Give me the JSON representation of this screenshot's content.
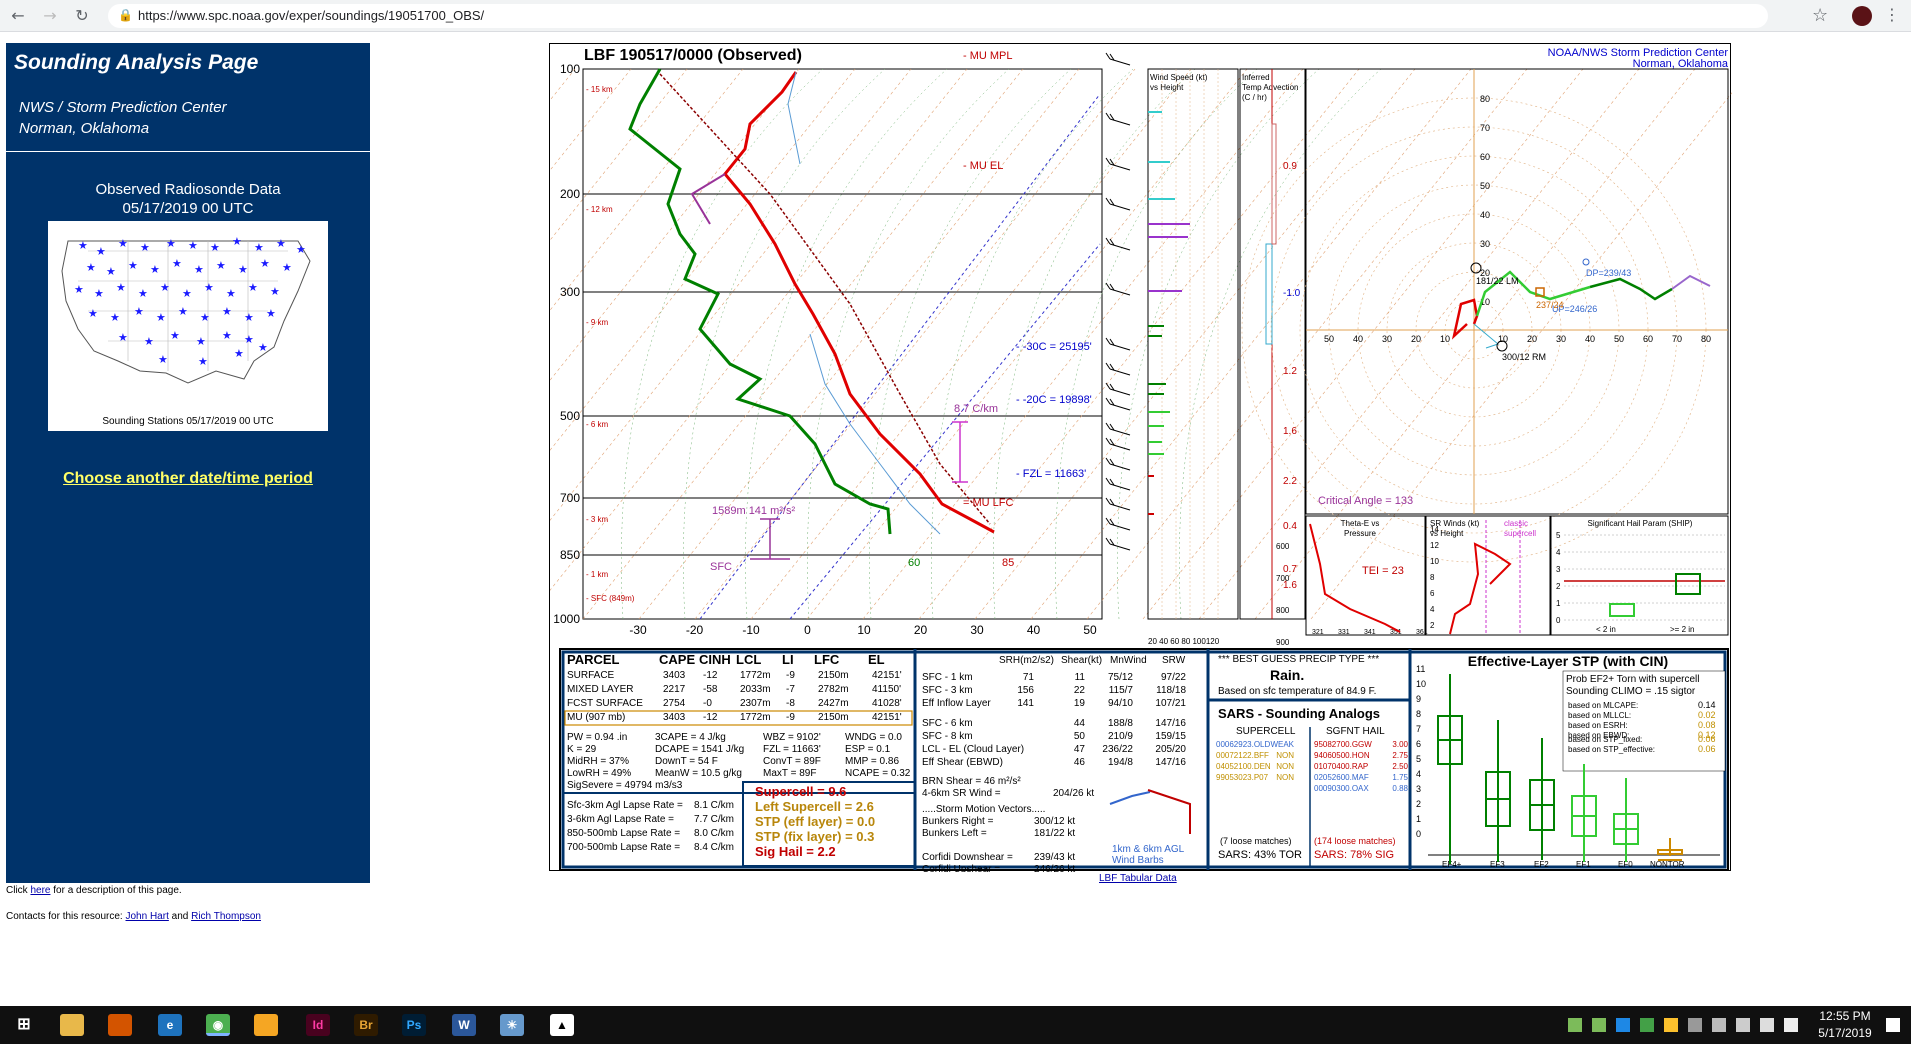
{
  "browser": {
    "url": "https://www.spc.noaa.gov/exper/soundings/19051700_OBS/"
  },
  "left": {
    "title": "Sounding Analysis Page",
    "sub1": "NWS / Storm Prediction Center",
    "sub2": "Norman, Oklahoma",
    "obs_title": "Observed Radiosonde Data",
    "obs_date": "05/17/2019 00 UTC",
    "map_caption": "Sounding Stations 05/17/2019 00 UTC",
    "choose_link": "Choose another date/time period"
  },
  "footer": {
    "click": "Click ",
    "here": "here",
    "desc": " for a description of this page.",
    "contacts": "Contacts for this resource: ",
    "name1": "John Hart",
    "and": " and ",
    "name2": "Rich Thompson"
  },
  "sounding": {
    "header": "LBF   190517/0000  (Observed)",
    "org1": "NOAA/NWS Storm Prediction Center",
    "org2": "Norman, Oklahoma",
    "mu_mpl": "MU MPL",
    "mu_el": "MU EL",
    "mu_lfc": "MU LFC",
    "lev_30c": "-30C = 25195'",
    "lev_20c": "-20C = 19898'",
    "fzl": "FZL = 11663'",
    "lapse": "8.7 C/km",
    "srh_lbl": "1589m    141 m²/s²",
    "sfc_lbl": "SFC",
    "td_sfc": "60",
    "t_sfc": "85",
    "press_labels": [
      "100",
      "200",
      "300",
      "500",
      "700",
      "850",
      "1000"
    ],
    "height_labels": [
      "15 km",
      "12 km",
      "9 km",
      "6 km",
      "3 km",
      "1 km",
      "SFC (849m)"
    ],
    "temp_ticks": [
      "-30",
      "-20",
      "-10",
      "0",
      "10",
      "20",
      "30",
      "40",
      "50"
    ],
    "wind_hdr1": "Wind Speed (kt)",
    "wind_hdr2": "vs Height",
    "adv_hdr1": "Inferred",
    "adv_hdr2": "Temp Advection",
    "adv_hdr3": "(C / hr)",
    "adv_vals": [
      "0.9",
      "-1.0",
      "1.2",
      "1.6",
      "2.2",
      "0.4",
      "0.7",
      "1.6"
    ],
    "wind_ticks": "20  40  60  80  100120",
    "hodo_labels": {
      "lm": "181/22 LM",
      "rm": "300/12 RM",
      "dp": "DP=239/43",
      "up": "UP=246/26",
      "crit": "Critical Angle = 133",
      "box": "237/24"
    },
    "hodo_rings": [
      "10",
      "20",
      "30",
      "40",
      "50",
      "60",
      "70",
      "80"
    ],
    "hodo_x": [
      "50",
      "40",
      "30",
      "20",
      "10",
      "10",
      "20",
      "30",
      "40",
      "50",
      "60",
      "70",
      "80"
    ]
  },
  "insets": {
    "theta_title1": "Theta-E vs",
    "theta_title2": "Pressure",
    "tei": "TEI = 23",
    "theta_x": [
      "321",
      "331",
      "341",
      "351",
      "361"
    ],
    "theta_p": [
      "600",
      "700",
      "800",
      "900"
    ],
    "srw_title1": "SR Winds (kt)",
    "srw_title2": "vs Height",
    "srw_classic1": "classic",
    "srw_classic2": "supercell",
    "srw_y": [
      "14",
      "12",
      "10",
      "8",
      "6",
      "4",
      "2"
    ],
    "ship_title": "Significant Hail Param (SHIP)",
    "ship_y": [
      "5",
      "4",
      "3",
      "2",
      "1",
      "0"
    ],
    "ship_x1": "< 2 in",
    "ship_x2": ">= 2 in"
  },
  "parcel_table": {
    "headers": [
      "PARCEL",
      "CAPE",
      "CINH",
      "LCL",
      "LI",
      "LFC",
      "EL"
    ],
    "rows": [
      [
        "SURFACE",
        "3403",
        "-12",
        "1772m",
        "-9",
        "2150m",
        "42151'"
      ],
      [
        "MIXED LAYER",
        "2217",
        "-58",
        "2033m",
        "-7",
        "2782m",
        "41150'"
      ],
      [
        "FCST SURFACE",
        "2754",
        "-0",
        "2307m",
        "-8",
        "2427m",
        "41028'"
      ],
      [
        "MU   (907 mb)",
        "3403",
        "-12",
        "1772m",
        "-9",
        "2150m",
        "42151'"
      ]
    ]
  },
  "indices": [
    [
      "PW = 0.94 .in",
      "3CAPE = 4 J/kg",
      "WBZ = 9102'",
      "WNDG = 0.0"
    ],
    [
      "K = 29",
      "DCAPE = 1541 J/kg",
      "FZL = 11663'",
      "ESP = 0.1"
    ],
    [
      "MidRH = 37%",
      "DownT = 54 F",
      "ConvT = 89F",
      "MMP = 0.86"
    ],
    [
      "LowRH = 49%",
      "MeanW = 10.5 g/kg",
      "MaxT = 89F",
      "NCAPE = 0.32"
    ]
  ],
  "sigsevere": "SigSevere = 49794 m3/s3",
  "lapse_rates": [
    [
      "Sfc-3km Agl Lapse Rate =",
      "8.1 C/km"
    ],
    [
      "3-6km Agl Lapse Rate =",
      "7.7 C/km"
    ],
    [
      "850-500mb Lapse Rate =",
      "8.0 C/km"
    ],
    [
      "700-500mb Lapse Rate =",
      "8.4 C/km"
    ]
  ],
  "composites": [
    {
      "label": "Supercell = 9.6",
      "color": "#c00000"
    },
    {
      "label": "Left Supercell = 2.6",
      "color": "#b8860b"
    },
    {
      "label": "STP (eff layer) = 0.0",
      "color": "#b8860b"
    },
    {
      "label": "STP (fix layer) = 0.3",
      "color": "#b8860b"
    },
    {
      "label": "Sig Hail = 2.2",
      "color": "#c00000"
    }
  ],
  "kinematics": {
    "headers": [
      "SRH(m2/s2)",
      "Shear(kt)",
      "MnWind",
      "SRW"
    ],
    "rows": [
      [
        "SFC - 1 km",
        "71",
        "11",
        "75/12",
        "97/22"
      ],
      [
        "SFC - 3 km",
        "156",
        "22",
        "115/7",
        "118/18"
      ],
      [
        "Eff Inflow Layer",
        "141",
        "19",
        "94/10",
        "107/21"
      ],
      [
        "SFC - 6 km",
        "",
        "44",
        "188/8",
        "147/16"
      ],
      [
        "SFC - 8 km",
        "",
        "50",
        "210/9",
        "159/15"
      ],
      [
        "LCL - EL (Cloud Layer)",
        "",
        "47",
        "236/22",
        "205/20"
      ],
      [
        "Eff Shear (EBWD)",
        "",
        "46",
        "194/8",
        "147/16"
      ]
    ],
    "brn": "BRN Shear = 46 m²/s²",
    "sr46": "4-6km SR Wind =",
    "sr46_val": "204/26 kt",
    "storm_hdr": ".....Storm Motion Vectors.....",
    "storm": [
      [
        "Bunkers Right =",
        "300/12 kt"
      ],
      [
        "Bunkers Left =",
        "181/22 kt"
      ],
      [
        "",
        ""
      ],
      [
        "Corfidi Downshear =",
        "239/43 kt"
      ],
      [
        "Corfidi Upshear =",
        "246/26 kt"
      ]
    ],
    "barb_label1": "1km & 6km AGL",
    "barb_label2": "Wind Barbs"
  },
  "precip": {
    "hdr": "*** BEST GUESS PRECIP TYPE ***",
    "type": "Rain.",
    "basis": "Based on sfc temperature of 84.9 F."
  },
  "sars": {
    "title": "SARS - Sounding Analogs",
    "col1": "SUPERCELL",
    "col2": "SGFNT HAIL",
    "supercell": [
      [
        "00062923.OLD",
        "WEAK",
        "#3366cc"
      ],
      [
        "00072122.BFF",
        "NON",
        "#c09000"
      ],
      [
        "04052100.DEN",
        "NON",
        "#c09000"
      ],
      [
        "99053023.P07",
        "NON",
        "#c09000"
      ]
    ],
    "hail": [
      [
        "95082700.GGW",
        "3.00",
        "#c00000"
      ],
      [
        "94060500.HON",
        "2.75",
        "#c00000"
      ],
      [
        "01070400.RAP",
        "2.50",
        "#c00000"
      ],
      [
        "02052600.MAF",
        "1.75",
        "#3366cc"
      ],
      [
        "00090300.OAX",
        "0.88",
        "#3366cc"
      ]
    ],
    "loose1": "(7 loose matches)",
    "loose2": "(174 loose matches)",
    "tor": "SARS:  43% TOR",
    "sig": "SARS:  78% SIG"
  },
  "stp": {
    "title": "Effective-Layer STP (with CIN)",
    "prob1": "Prob EF2+ Torn with supercell",
    "prob2": "Sounding CLIMO = .15 sigtor",
    "rows": [
      [
        "based on MLCAPE:",
        "0.14",
        "#000000"
      ],
      [
        "based on MLLCL:",
        "0.02",
        "#c09000"
      ],
      [
        "based on ESRH:",
        "0.08",
        "#c09000"
      ],
      [
        "based on EBWD:",
        "0.12",
        "#c09000"
      ],
      [
        "based on STP_fixed:",
        "0.06",
        "#c09000"
      ],
      [
        "based on STP_effective:",
        "0.06",
        "#c09000"
      ]
    ],
    "y_ticks": [
      "11",
      "10",
      "9",
      "8",
      "7",
      "6",
      "5",
      "4",
      "3",
      "2",
      "1",
      "0"
    ],
    "cats": [
      "EF4+",
      "EF3",
      "EF2",
      "EF1",
      "EF0",
      "NONTOR"
    ]
  },
  "tabular": "LBF Tabular Data",
  "taskbar": {
    "time": "12:55 PM",
    "date": "5/17/2019"
  },
  "colors": {
    "panel_blue": "#00336a",
    "link_yellow": "#ffff66",
    "temp_red": "#e00000",
    "dew_green": "#008000"
  }
}
